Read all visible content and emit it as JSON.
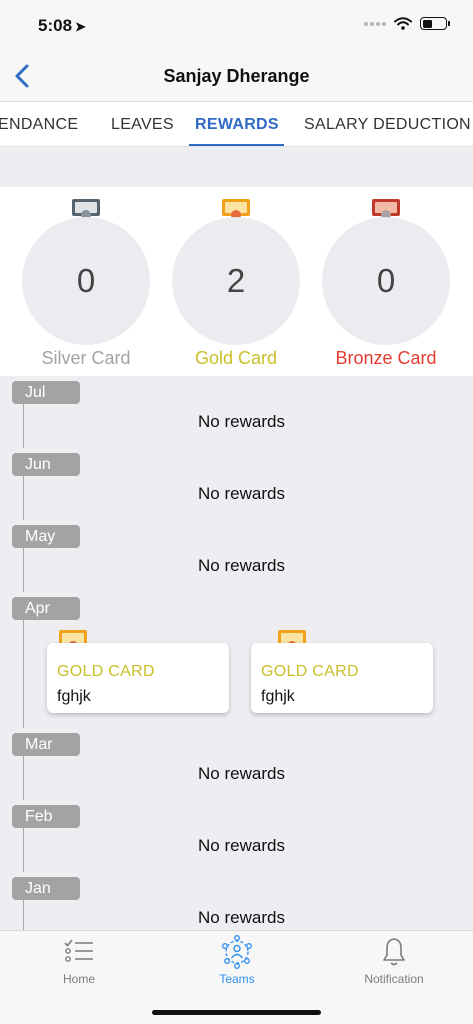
{
  "status_bar": {
    "time": "5:08",
    "location_glyph": "➤"
  },
  "nav": {
    "title": "Sanjay Dherange",
    "back_icon": "chevron-left-icon"
  },
  "tabs": [
    {
      "label": "ENDANCE",
      "active": false
    },
    {
      "label": "LEAVES",
      "active": false
    },
    {
      "label": "REWARDS",
      "active": true
    },
    {
      "label": "SALARY DEDUCTION",
      "active": false
    }
  ],
  "summary": {
    "cards": [
      {
        "label": "Silver Card",
        "count": "0",
        "color": "#a3a3a3"
      },
      {
        "label": "Gold Card",
        "count": "2",
        "color": "#c9bf26"
      },
      {
        "label": "Bronze Card",
        "count": "0",
        "color": "#e53c2f"
      }
    ]
  },
  "timeline": {
    "months": [
      {
        "name": "Jul",
        "message": "No rewards"
      },
      {
        "name": "Jun",
        "message": "No rewards"
      },
      {
        "name": "May",
        "message": "No rewards"
      },
      {
        "name": "Apr",
        "rewards": [
          {
            "type": "GOLD CARD",
            "name": "fghjk"
          },
          {
            "type": "GOLD CARD",
            "name": "fghjk"
          }
        ]
      },
      {
        "name": "Mar",
        "message": "No rewards"
      },
      {
        "name": "Feb",
        "message": "No rewards"
      },
      {
        "name": "Jan",
        "message": "No rewards"
      }
    ]
  },
  "bottom_tabs": [
    {
      "label": "Home",
      "icon": "checklist-icon",
      "active": false
    },
    {
      "label": "Teams",
      "icon": "team-network-icon",
      "active": true
    },
    {
      "label": "Notification",
      "icon": "bell-icon",
      "active": false
    }
  ],
  "colors": {
    "accent": "#2f6ac4",
    "tab_active": "#2f8ef0",
    "gold": "#c9bf26",
    "bronze": "#e53c2f",
    "silver": "#a3a3a3"
  }
}
